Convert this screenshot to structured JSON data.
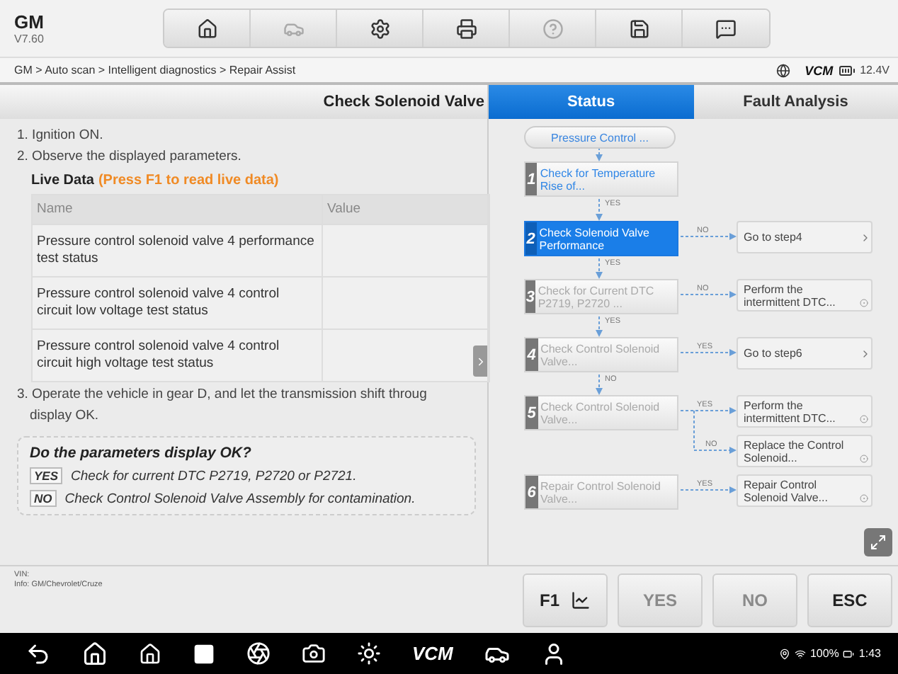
{
  "header": {
    "app": "GM",
    "version": "V7.60",
    "tools": [
      {
        "kind": "home",
        "disabled": false
      },
      {
        "kind": "lift",
        "disabled": true
      },
      {
        "kind": "settings",
        "disabled": false
      },
      {
        "kind": "print",
        "disabled": false
      },
      {
        "kind": "help",
        "disabled": true
      },
      {
        "kind": "save",
        "disabled": false
      },
      {
        "kind": "chat",
        "disabled": false
      }
    ]
  },
  "breadcrumb": "GM > Auto scan > Intelligent diagnostics > Repair Assist",
  "link_status": {
    "vcm": "VCM",
    "voltage": "12.4V"
  },
  "procedure": {
    "title": "Check Solenoid Valve",
    "steps": [
      "1. Ignition ON.",
      "2. Observe the displayed parameters."
    ],
    "live_data": {
      "label": "Live Data",
      "hint": "(Press F1 to read live data)",
      "columns": [
        "Name",
        "Value"
      ],
      "rows": [
        {
          "name": "Pressure control solenoid valve 4 performance test status"
        },
        {
          "name": "Pressure control solenoid valve 4 control circuit low voltage test status"
        },
        {
          "name": "Pressure control solenoid valve 4 control circuit high voltage test status"
        }
      ]
    },
    "step3": [
      "3. Operate the vehicle in gear D, and let the transmission shift throug",
      "display OK."
    ],
    "question": {
      "title": "Do the parameters display OK?",
      "answers": [
        {
          "tag": "YES",
          "text": "Check for current DTC P2719, P2720 or P2721."
        },
        {
          "tag": "NO",
          "text": "Check Control Solenoid Valve Assembly for contamination."
        }
      ]
    }
  },
  "tabs": [
    {
      "label": "Status",
      "selected": true
    },
    {
      "label": "Fault Analysis",
      "selected": false
    }
  ],
  "flow": {
    "start": "Pressure Control ...",
    "steps": [
      {
        "number": "1",
        "text": "Check for Temperature Rise of...",
        "done": true,
        "selected": false
      },
      {
        "number": "2",
        "text": "Check Solenoid Valve Performance",
        "done": false,
        "selected": true
      },
      {
        "number": "3",
        "text": "Check for Current DTC P2719, P2720 ...",
        "done": false,
        "selected": false
      },
      {
        "number": "4",
        "text": "Check Control Solenoid Valve...",
        "done": false,
        "selected": false
      },
      {
        "number": "5",
        "text": "Check Control Solenoid Valve...",
        "done": false,
        "selected": false
      },
      {
        "number": "6",
        "text": "Repair Control Solenoid Valve...",
        "done": false,
        "selected": false
      }
    ],
    "down_labels": [
      "YES",
      "YES",
      "YES",
      "NO"
    ],
    "outcomes": [
      {
        "text": "Go to step4",
        "kind": "goto",
        "label": "NO"
      },
      {
        "text": "Perform the intermittent DTC...",
        "kind": "action",
        "label": "NO"
      },
      {
        "text": "Go to step6",
        "kind": "goto",
        "label": "YES"
      },
      {
        "text": "Perform the intermittent DTC...",
        "kind": "action",
        "label": "YES"
      },
      {
        "text": "Replace the Control Solenoid...",
        "kind": "action",
        "label": "NO"
      },
      {
        "text": "Repair Control Solenoid Valve...",
        "kind": "action",
        "label": "YES"
      }
    ]
  },
  "vehicle": {
    "vin": "VIN:",
    "info": "Info: GM/Chevrolet/Cruze"
  },
  "actions": [
    {
      "label": "F1",
      "kind": "f1",
      "disabled": false
    },
    {
      "label": "YES",
      "kind": "plain",
      "disabled": true
    },
    {
      "label": "NO",
      "kind": "plain",
      "disabled": true
    },
    {
      "label": "ESC",
      "kind": "plain",
      "disabled": false
    }
  ],
  "system_bar": {
    "vcm": "VCM",
    "battery": "100%",
    "time": "1:43"
  }
}
